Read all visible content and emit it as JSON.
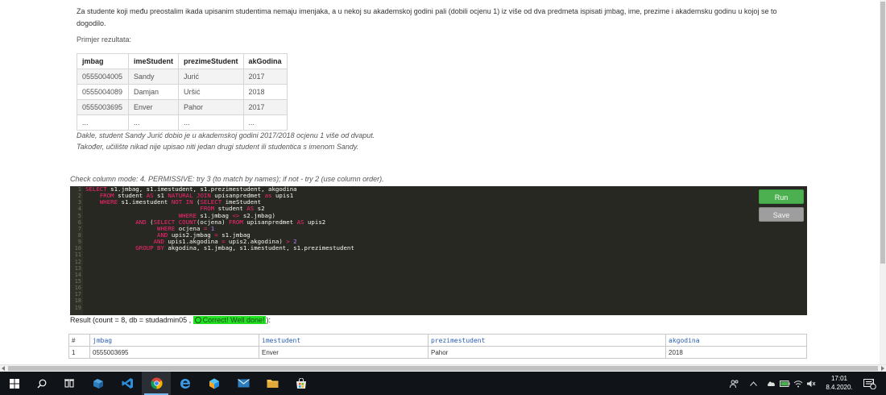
{
  "task": {
    "description": "Za studente koji među preostalim ikada upisanim studentima nemaju imenjaka, a u nekoj su akademskoj godini pali (dobili ocjenu 1) iz više od dva predmeta ispisati jmbag, ime, prezime i akademsku godinu u kojoj se to dogodilo.",
    "example_label": "Primjer rezultata:",
    "example_table": {
      "headers": [
        "jmbag",
        "imeStudent",
        "prezimeStudent",
        "akGodina"
      ],
      "rows": [
        [
          "0555004005",
          "Sandy",
          "Jurić",
          "2017"
        ],
        [
          "0555004089",
          "Damjan",
          "Uršić",
          "2018"
        ],
        [
          "0555003695",
          "Enver",
          "Pahor",
          "2017"
        ],
        [
          "...",
          "...",
          "...",
          "..."
        ]
      ]
    },
    "explanation_1": "Dakle, student Sandy Jurić dobio je u akademskoj godini 2017/2018 ocjenu 1 više od dvaput.",
    "explanation_2": "Također, učilište nikad nije upisao niti jedan drugi student ili studentica s imenom Sandy."
  },
  "check_mode": "Check column mode: 4. PERMISSIVE: try 3 (to match by names); if not - try 2 (use column order).",
  "editor": {
    "line_numbers": [
      "1",
      "2",
      "3",
      "4",
      "5",
      "6",
      "7",
      "8",
      "9",
      "10",
      "11",
      "12",
      "13",
      "14",
      "15",
      "16",
      "17",
      "18",
      "19"
    ],
    "code_lines": [
      "SELECT s1.jmbag, s1.imestudent, s1.prezimestudent, akgodina",
      "    FROM student AS s1 NATURAL JOIN upisanpredmet as upis1",
      "    WHERE s1.imestudent NOT IN (SELECT imeStudent",
      "                                FROM student AS s2",
      "                          WHERE s1.jmbag <> s2.jmbag)",
      "              AND (SELECT COUNT(ocjena) FROM upisanpredmet AS upis2",
      "                    WHERE ocjena = 1",
      "                    AND upis2.jmbag = s1.jmbag",
      "                   AND upis1.akgodina = upis2.akgodina) > 2",
      "              GROUP BY akgodina, s1.jmbag, s1.imestudent, s1.prezimestudent"
    ]
  },
  "buttons": {
    "run": "Run",
    "save": "Save"
  },
  "result": {
    "prefix": "Result (count = 8, db = studadmin05 ,",
    "badge": "Correct! Well done!",
    "suffix": "):",
    "headers": [
      "#",
      "jmbag",
      "imestudent",
      "prezimestudent",
      "akgodina"
    ],
    "rows": [
      [
        "1",
        "0555003695",
        "Enver",
        "Pahor",
        "2018"
      ]
    ]
  },
  "taskbar": {
    "icons": [
      "windows-start-icon",
      "search-icon",
      "task-view-icon",
      "file-explorer-icon",
      "vscode-icon",
      "chrome-icon",
      "edge-icon",
      "app-icon",
      "mail-icon",
      "folder-icon",
      "store-icon"
    ],
    "time": "17:01",
    "date": "8.4.2020.",
    "notification_count": "2"
  }
}
